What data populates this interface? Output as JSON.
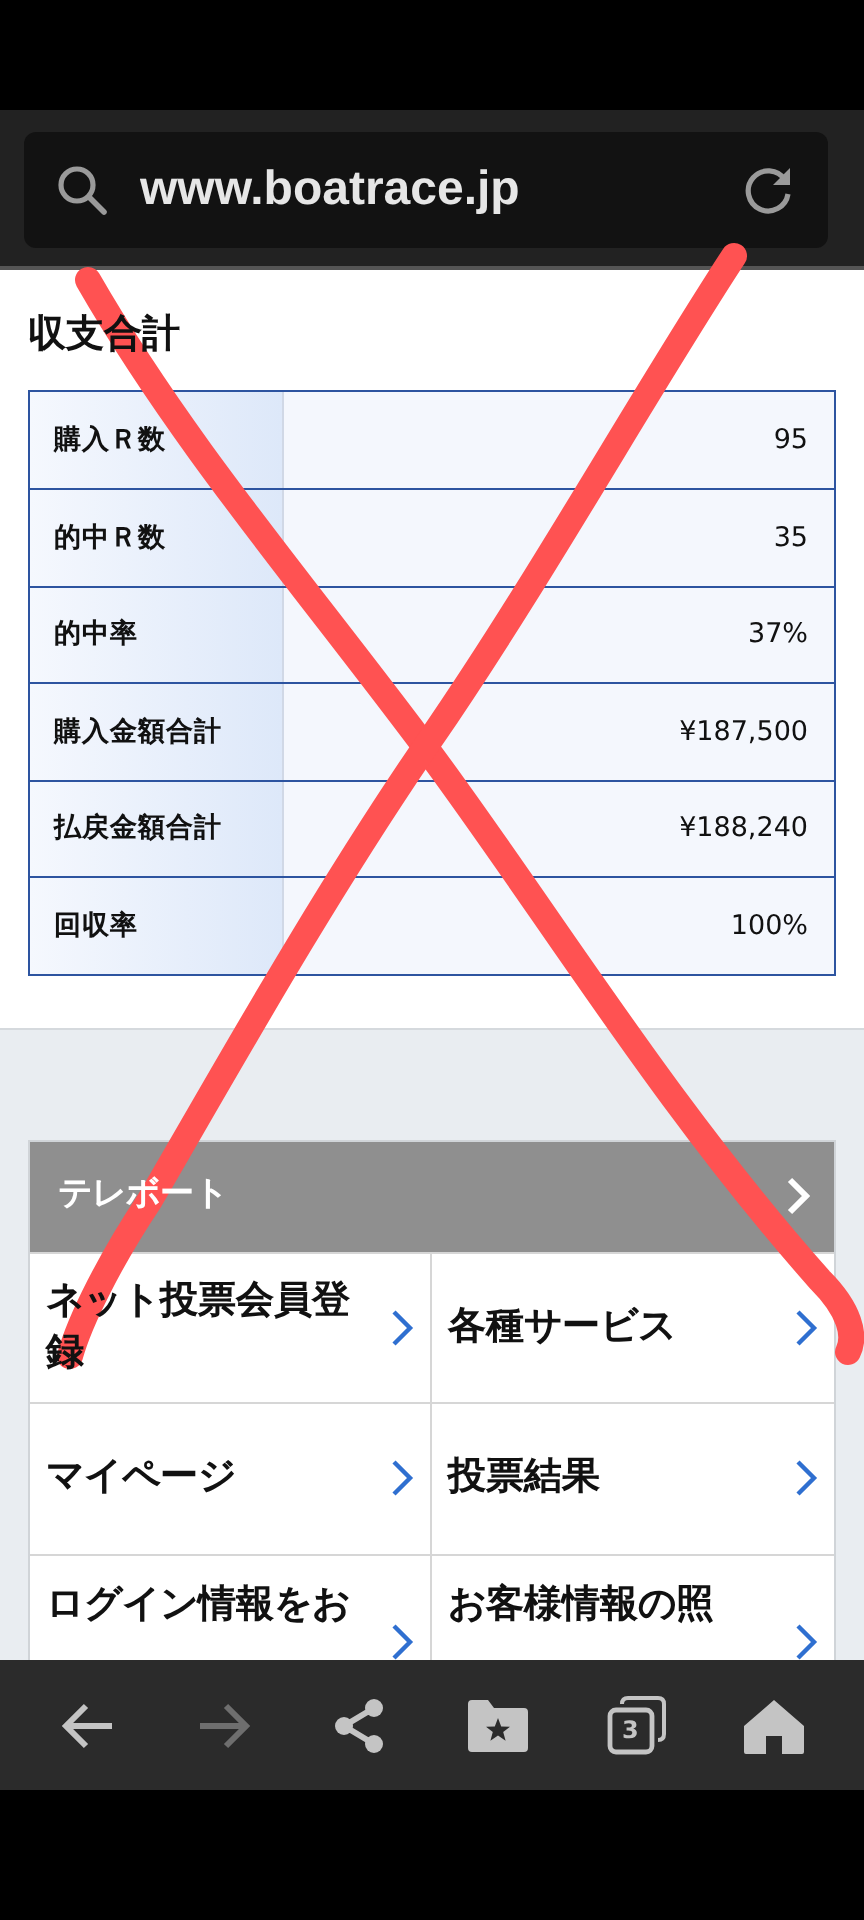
{
  "address_bar": {
    "url": "www.boatrace.jp"
  },
  "heading": "収支合計",
  "summary_rows": [
    {
      "label": "購入Ｒ数",
      "value": "95"
    },
    {
      "label": "的中Ｒ数",
      "value": "35"
    },
    {
      "label": "的中率",
      "value": "37%"
    },
    {
      "label": "購入金額合計",
      "value": "¥187,500"
    },
    {
      "label": "払戻金額合計",
      "value": "¥188,240"
    },
    {
      "label": "回収率",
      "value": "100%"
    }
  ],
  "menu_card": {
    "title": "テレボート",
    "items": [
      {
        "label": "ネット投票会員登録",
        "kind": "full"
      },
      {
        "label": "各種サービス",
        "kind": "full"
      },
      {
        "label": "マイページ",
        "kind": "full"
      },
      {
        "label": "投票結果",
        "kind": "full"
      },
      {
        "label": "ログイン情報をお",
        "kind": "cut"
      },
      {
        "label": "お客様情報の照",
        "kind": "cut"
      }
    ]
  },
  "toolbar": {
    "buttons": [
      {
        "kind": "back",
        "disabled": false
      },
      {
        "kind": "forward",
        "disabled": true
      },
      {
        "kind": "share",
        "disabled": false
      },
      {
        "kind": "bookmarks",
        "disabled": false
      },
      {
        "kind": "tabs",
        "disabled": false,
        "count": "3"
      },
      {
        "kind": "home",
        "disabled": false
      }
    ]
  },
  "annotation": {
    "kind": "cross"
  }
}
